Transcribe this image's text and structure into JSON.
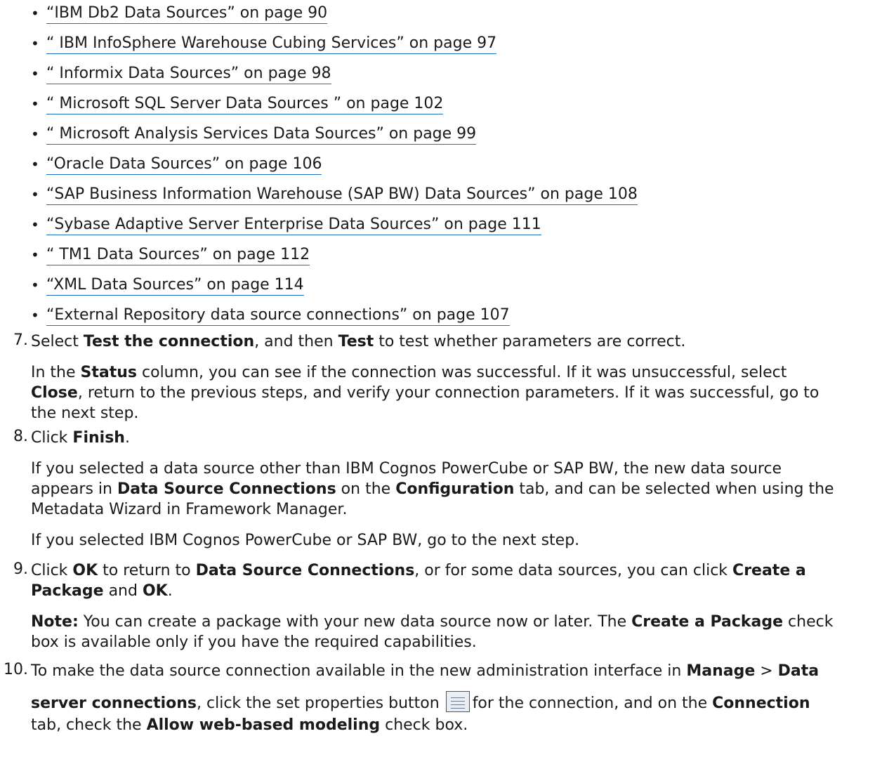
{
  "links": [
    "“IBM Db2 Data Sources” on page 90",
    "“ IBM InfoSphere Warehouse Cubing Services” on page 97",
    "“ Informix Data Sources” on page 98",
    "“ Microsoft SQL Server Data Sources ” on page 102",
    "“ Microsoft Analysis Services Data Sources” on page 99",
    "“Oracle Data Sources” on page 106",
    "“SAP Business Information Warehouse (SAP BW) Data Sources” on page 108",
    "“Sybase Adaptive Server Enterprise Data Sources” on page 111",
    "“ TM1 Data Sources” on page 112",
    "“XML Data Sources” on page 114",
    "“External Repository data source connections” on page 107"
  ],
  "step7": {
    "num": "7.",
    "a": "Select ",
    "b": "Test the connection",
    "c": ", and then ",
    "d": "Test",
    "e": " to test whether parameters are correct.",
    "p2a": "In the ",
    "p2b": "Status",
    "p2c": " column, you can see if the connection was successful. If it was unsuccessful, select",
    "p3a": "Close",
    "p3b": ", return to the previous steps, and verify your connection parameters. If it was successful, go to",
    "p4": "the next step."
  },
  "step8": {
    "num": "8.",
    "a": "Click ",
    "b": "Finish",
    "c": ".",
    "p2": "If you selected a data source other than IBM Cognos PowerCube or SAP BW, the new data source",
    "p3a": "appears in ",
    "p3b": "Data Source Connections",
    "p3c": " on the ",
    "p3d": "Configuration",
    "p3e": " tab, and can be selected when using the",
    "p4": "Metadata Wizard in Framework Manager.",
    "p5": "If you selected IBM Cognos PowerCube or SAP BW, go to the next step."
  },
  "step9": {
    "num": "9.",
    "a": "Click ",
    "b": "OK",
    "c": " to return to ",
    "d": "Data Source Connections",
    "e": ", or for some data sources, you can click ",
    "f": "Create a",
    "g": "Package",
    "h": " and ",
    "i": "OK",
    "j": ".",
    "n1": "Note:",
    "n2": " You can create a package with your new data source now or later. The ",
    "n3": "Create a Package",
    "n4": " check",
    "n5": "box is available only if you have the required capabilities."
  },
  "step10": {
    "num": "10.",
    "a": "To make the data source connection available in the new administration interface in ",
    "b": "Manage",
    "c": " > ",
    "d": "Data",
    "e": "server connections",
    "f": ", click the set properties button ",
    "g": "for the connection, and on the ",
    "h": "Connection",
    "i": "tab, check the ",
    "j": "Allow web-based modeling",
    "k": " check box.",
    "icon": "set-properties-icon"
  }
}
